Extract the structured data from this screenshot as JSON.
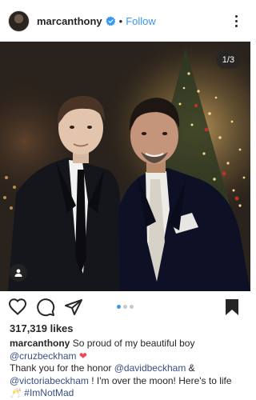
{
  "post": {
    "username": "marcanthony",
    "follow_dot": "•",
    "follow_label": "Follow",
    "counter": "1/3",
    "likes": "317,319 likes",
    "colors": {
      "accent": "#3897f0",
      "text": "#262626",
      "mention": "#385185",
      "heart": "#ed4956"
    }
  },
  "caption": {
    "username": "marcanthony",
    "line1": " So proud of my beautiful boy",
    "mention_cruz": "@cruzbeckham",
    "heart": " ❤",
    "text_thank": "Thank you for the honor ",
    "mention_david": "@davidbeckham",
    "text_amp": " &",
    "mention_victoria": "@victoriabeckham",
    "text_moon": " ! I'm over the moon! Here's to life",
    "emoji": "🥂",
    "hashtag": " #ImNotMad"
  },
  "icons": {
    "verified": "verified-badge-icon",
    "more": "more-options-icon",
    "like": "heart-icon",
    "comment": "comment-icon",
    "share": "send-icon",
    "save": "bookmark-icon",
    "tag": "person-tag-icon"
  }
}
